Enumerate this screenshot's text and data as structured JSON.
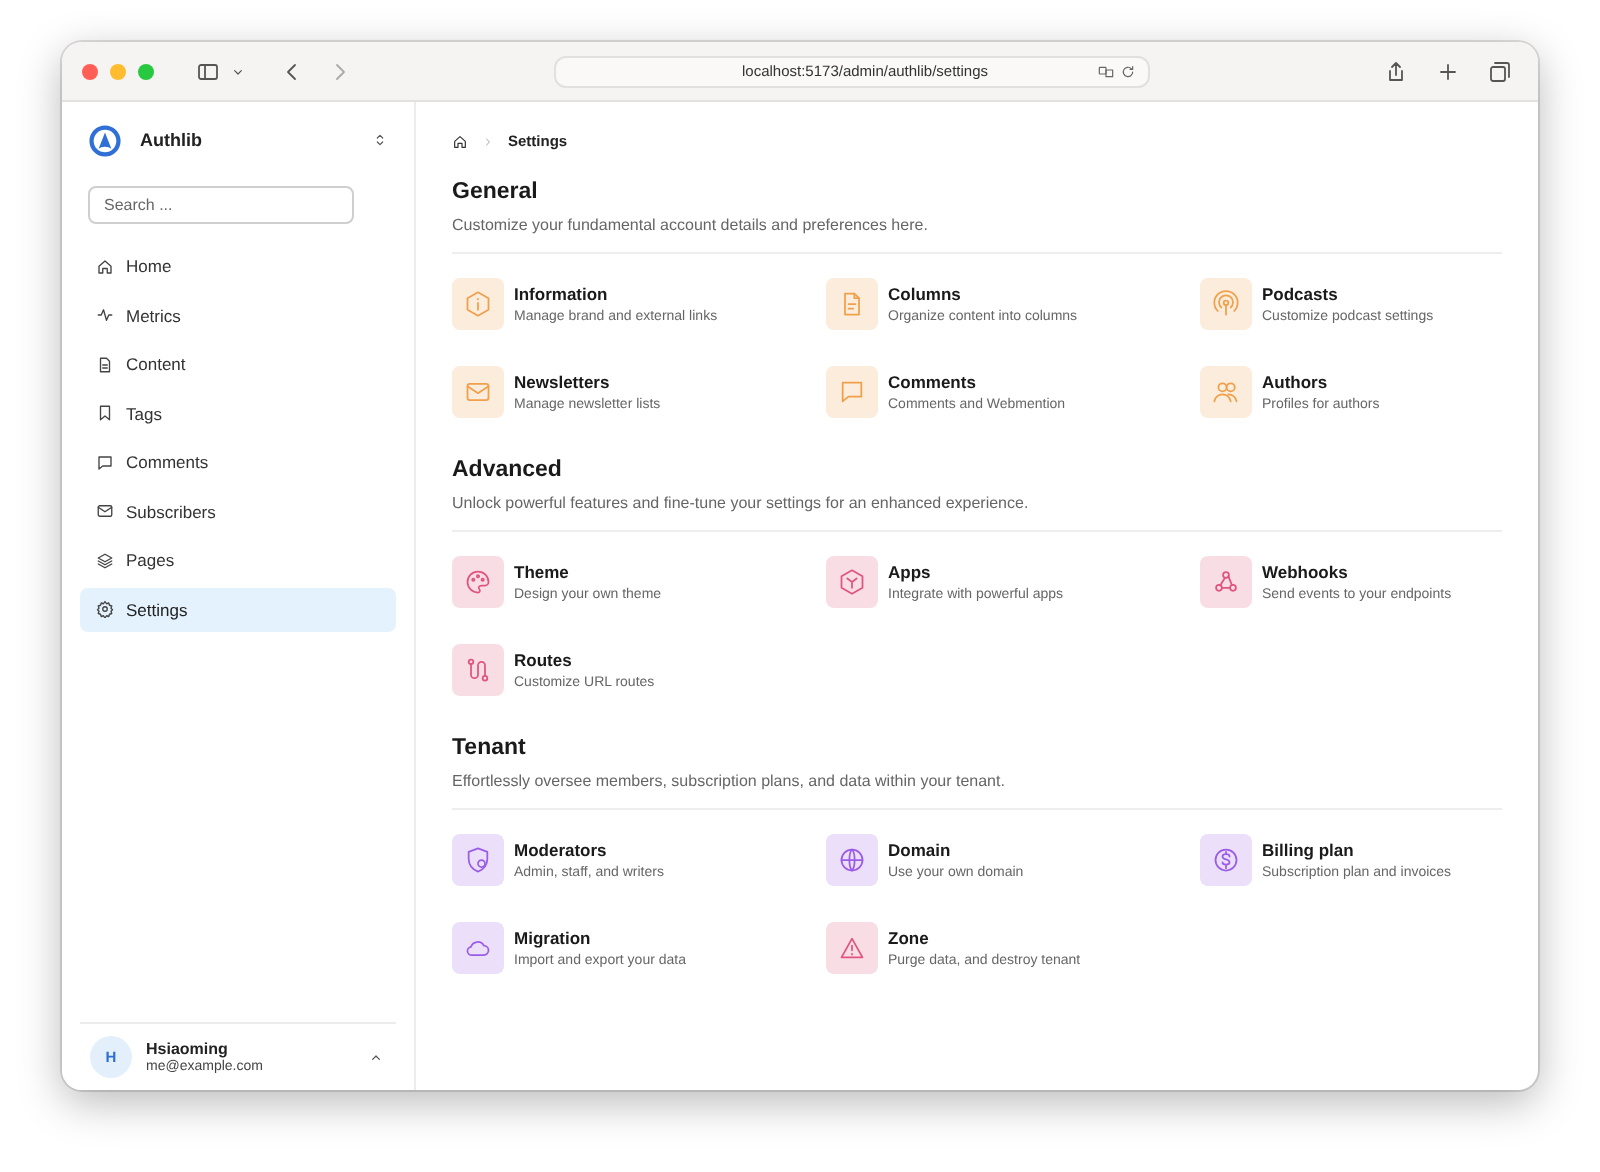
{
  "browser": {
    "url": "localhost:5173/admin/authlib/settings"
  },
  "sidebar": {
    "brand": "Authlib",
    "search": {
      "placeholder": "Search ..."
    },
    "items": [
      {
        "label": "Home",
        "kind": "home",
        "selected": false
      },
      {
        "label": "Metrics",
        "kind": "pulse",
        "selected": false
      },
      {
        "label": "Content",
        "kind": "file",
        "selected": false
      },
      {
        "label": "Tags",
        "kind": "bookmark",
        "selected": false
      },
      {
        "label": "Comments",
        "kind": "chat",
        "selected": false
      },
      {
        "label": "Subscribers",
        "kind": "mail",
        "selected": false
      },
      {
        "label": "Pages",
        "kind": "layers",
        "selected": false
      },
      {
        "label": "Settings",
        "kind": "gear",
        "selected": true
      }
    ],
    "user": {
      "initial": "H",
      "name": "Hsiaoming",
      "email": "me@example.com"
    }
  },
  "breadcrumb": {
    "current": "Settings"
  },
  "sections": [
    {
      "title": "General",
      "description": "Customize your fundamental account details and preferences here.",
      "items": [
        {
          "title": "Information",
          "subtitle": "Manage brand and external links",
          "kind": "info",
          "color": "#f0a04b"
        },
        {
          "title": "Columns",
          "subtitle": "Organize content into columns",
          "kind": "doc",
          "color": "#f0a04b"
        },
        {
          "title": "Podcasts",
          "subtitle": "Customize podcast settings",
          "kind": "podcast",
          "color": "#f0a04b"
        },
        {
          "title": "Newsletters",
          "subtitle": "Manage newsletter lists",
          "kind": "mail",
          "color": "#f0a04b"
        },
        {
          "title": "Comments",
          "subtitle": "Comments and Webmention",
          "kind": "chat",
          "color": "#f0a04b"
        },
        {
          "title": "Authors",
          "subtitle": "Profiles for authors",
          "kind": "users",
          "color": "#f0a04b"
        }
      ]
    },
    {
      "title": "Advanced",
      "description": "Unlock powerful features and fine-tune your settings for an enhanced experience.",
      "items": [
        {
          "title": "Theme",
          "subtitle": "Design your own theme",
          "kind": "palette",
          "color": "#e0557f"
        },
        {
          "title": "Apps",
          "subtitle": "Integrate with powerful apps",
          "kind": "hexagon",
          "color": "#e0557f"
        },
        {
          "title": "Webhooks",
          "subtitle": "Send events to your endpoints",
          "kind": "webhook",
          "color": "#e0557f"
        },
        {
          "title": "Routes",
          "subtitle": "Customize URL routes",
          "kind": "route",
          "color": "#e0557f"
        }
      ]
    },
    {
      "title": "Tenant",
      "description": "Effortlessly oversee members, subscription plans, and data within your tenant.",
      "items": [
        {
          "title": "Moderators",
          "subtitle": "Admin, staff, and writers",
          "kind": "shield",
          "color": "#9b5de5"
        },
        {
          "title": "Domain",
          "subtitle": "Use your own domain",
          "kind": "globe",
          "color": "#9b5de5"
        },
        {
          "title": "Billing plan",
          "subtitle": "Subscription plan and invoices",
          "kind": "dollar",
          "color": "#9b5de5"
        },
        {
          "title": "Migration",
          "subtitle": "Import and export your data",
          "kind": "cloud",
          "color": "#9b5de5"
        },
        {
          "title": "Zone",
          "subtitle": "Purge data, and destroy tenant",
          "kind": "alert",
          "color": "#e0557f"
        }
      ]
    }
  ]
}
